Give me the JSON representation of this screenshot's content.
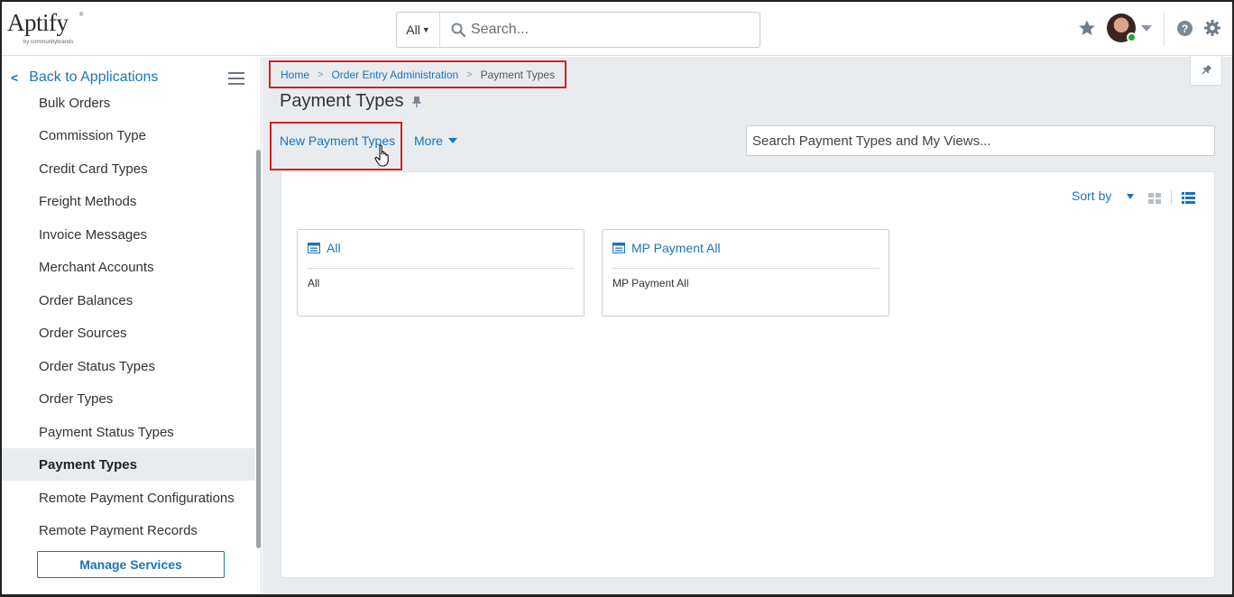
{
  "header": {
    "logo_text": "Aptify",
    "logo_sub": "by communitybrands",
    "search_scope": "All",
    "search_placeholder": "Search..."
  },
  "sidebar": {
    "back_label": "Back to Applications",
    "items": [
      {
        "label": "Bulk Orders",
        "active": false
      },
      {
        "label": "Commission Type",
        "active": false
      },
      {
        "label": "Credit Card Types",
        "active": false
      },
      {
        "label": "Freight Methods",
        "active": false
      },
      {
        "label": "Invoice Messages",
        "active": false
      },
      {
        "label": "Merchant Accounts",
        "active": false
      },
      {
        "label": "Order Balances",
        "active": false
      },
      {
        "label": "Order Sources",
        "active": false
      },
      {
        "label": "Order Status Types",
        "active": false
      },
      {
        "label": "Order Types",
        "active": false
      },
      {
        "label": "Payment Status Types",
        "active": false
      },
      {
        "label": "Payment Types",
        "active": true
      },
      {
        "label": "Remote Payment Configurations",
        "active": false
      },
      {
        "label": "Remote Payment Records",
        "active": false
      }
    ],
    "manage_label": "Manage Services"
  },
  "breadcrumb": {
    "home": "Home",
    "parent": "Order Entry Administration",
    "current": "Payment Types"
  },
  "page": {
    "title": "Payment Types",
    "new_button": "New Payment Types",
    "more_button": "More",
    "views_search_placeholder": "Search Payment Types and My Views...",
    "sort_label": "Sort by"
  },
  "cards": [
    {
      "title": "All",
      "body": "All"
    },
    {
      "title": "MP Payment All",
      "body": "MP Payment All"
    }
  ],
  "colors": {
    "accent": "#1a75bb",
    "highlight": "#d42127",
    "status_online": "#1aa33c"
  }
}
